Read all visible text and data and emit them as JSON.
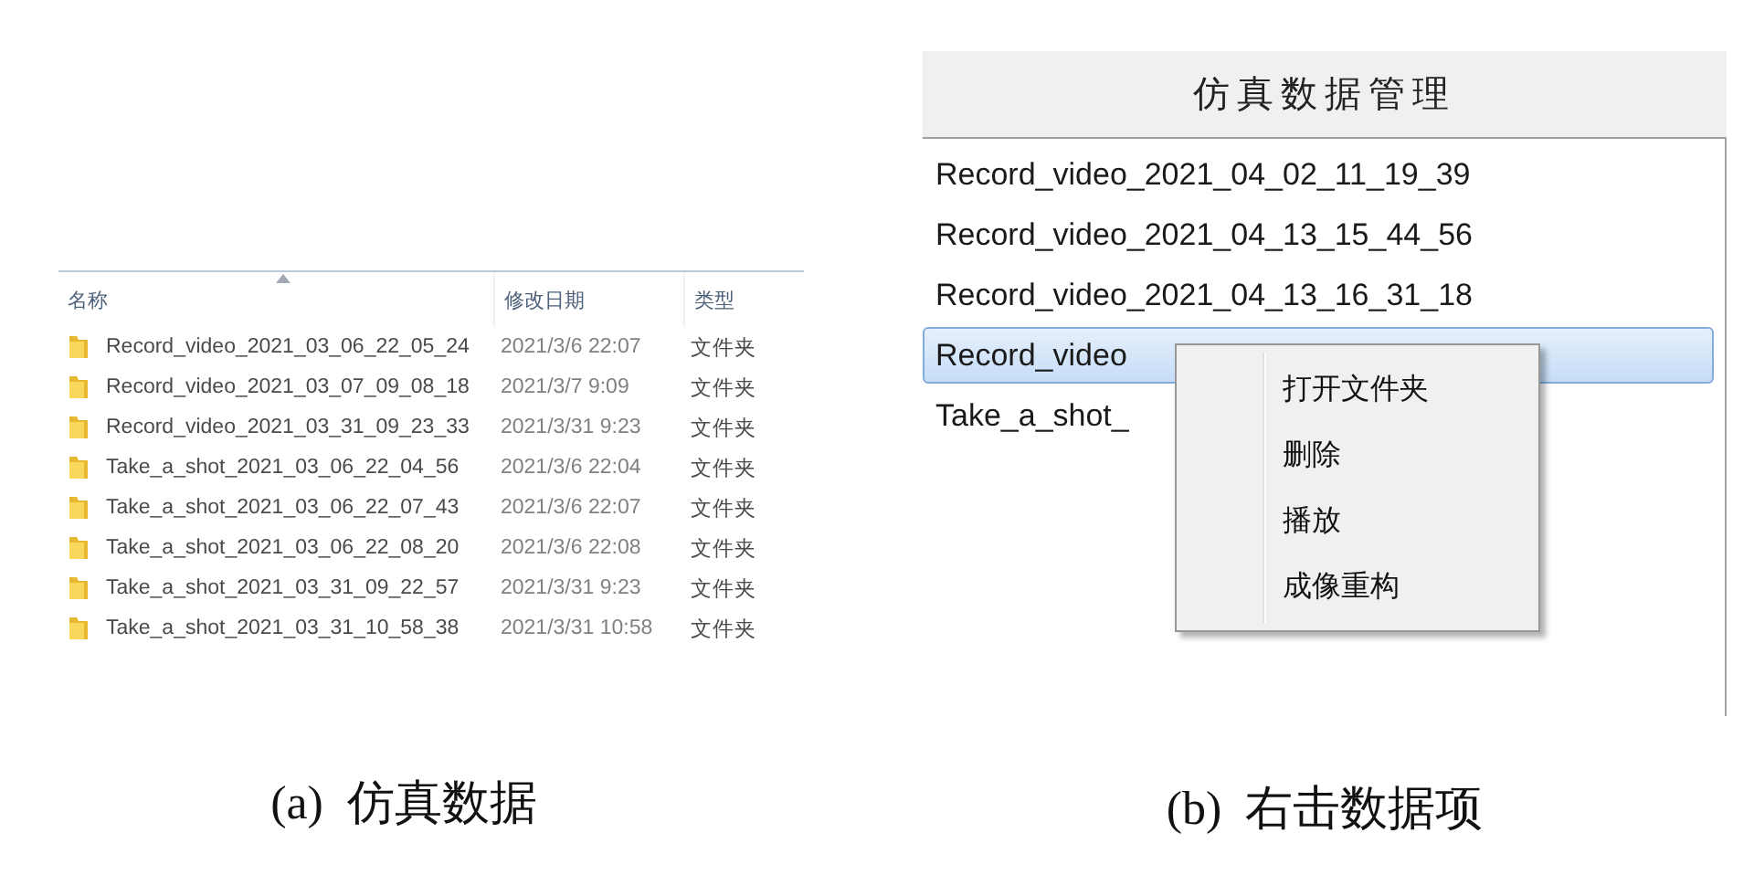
{
  "explorer": {
    "columns": [
      {
        "label": "名称",
        "sorted": true
      },
      {
        "label": "修改日期",
        "sorted": false
      },
      {
        "label": "类型",
        "sorted": false
      }
    ],
    "rows": [
      {
        "name": "Record_video_2021_03_06_22_05_24",
        "modified": "2021/3/6 22:07",
        "type": "文件夹"
      },
      {
        "name": "Record_video_2021_03_07_09_08_18",
        "modified": "2021/3/7 9:09",
        "type": "文件夹"
      },
      {
        "name": "Record_video_2021_03_31_09_23_33",
        "modified": "2021/3/31 9:23",
        "type": "文件夹"
      },
      {
        "name": "Take_a_shot_2021_03_06_22_04_56",
        "modified": "2021/3/6 22:04",
        "type": "文件夹"
      },
      {
        "name": "Take_a_shot_2021_03_06_22_07_43",
        "modified": "2021/3/6 22:07",
        "type": "文件夹"
      },
      {
        "name": "Take_a_shot_2021_03_06_22_08_20",
        "modified": "2021/3/6 22:08",
        "type": "文件夹"
      },
      {
        "name": "Take_a_shot_2021_03_31_09_22_57",
        "modified": "2021/3/31 9:23",
        "type": "文件夹"
      },
      {
        "name": "Take_a_shot_2021_03_31_10_58_38",
        "modified": "2021/3/31 10:58",
        "type": "文件夹"
      }
    ]
  },
  "caption_a": "(a)  仿真数据",
  "manager": {
    "title": "仿真数据管理",
    "items": [
      {
        "label": "Record_video_2021_04_02_11_19_39",
        "selected": false
      },
      {
        "label": "Record_video_2021_04_13_15_44_56",
        "selected": false
      },
      {
        "label": "Record_video_2021_04_13_16_31_18",
        "selected": false
      },
      {
        "label": "Record_video",
        "selected": true
      },
      {
        "label": "Take_a_shot_",
        "selected": false
      }
    ],
    "context_menu": [
      "打开文件夹",
      "删除",
      "播放",
      "成像重构"
    ]
  },
  "caption_b": "(b)  右击数据项"
}
